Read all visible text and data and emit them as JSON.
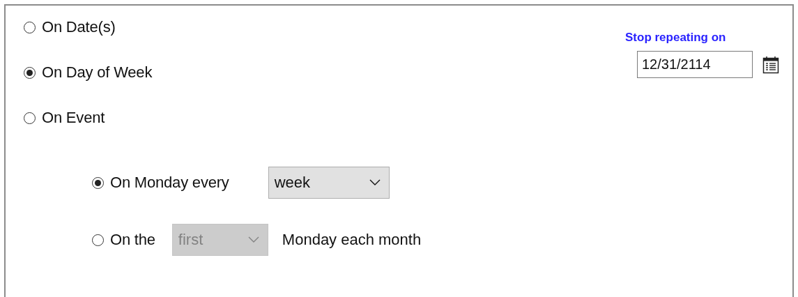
{
  "repeat_modes": [
    {
      "label": "On Date(s)",
      "selected": false
    },
    {
      "label": "On Day of Week",
      "selected": true
    },
    {
      "label": "On Event",
      "selected": false
    }
  ],
  "weekday_options": [
    {
      "kind": "every",
      "label": "On Monday every",
      "selected": true,
      "select": {
        "value": "week",
        "disabled": false
      }
    },
    {
      "kind": "nth",
      "label": "On the",
      "selected": false,
      "select": {
        "value": "first",
        "disabled": true
      },
      "suffix": "Monday each month"
    }
  ],
  "stop_repeating": {
    "label": "Stop repeating on",
    "value": "12/31/2114"
  }
}
